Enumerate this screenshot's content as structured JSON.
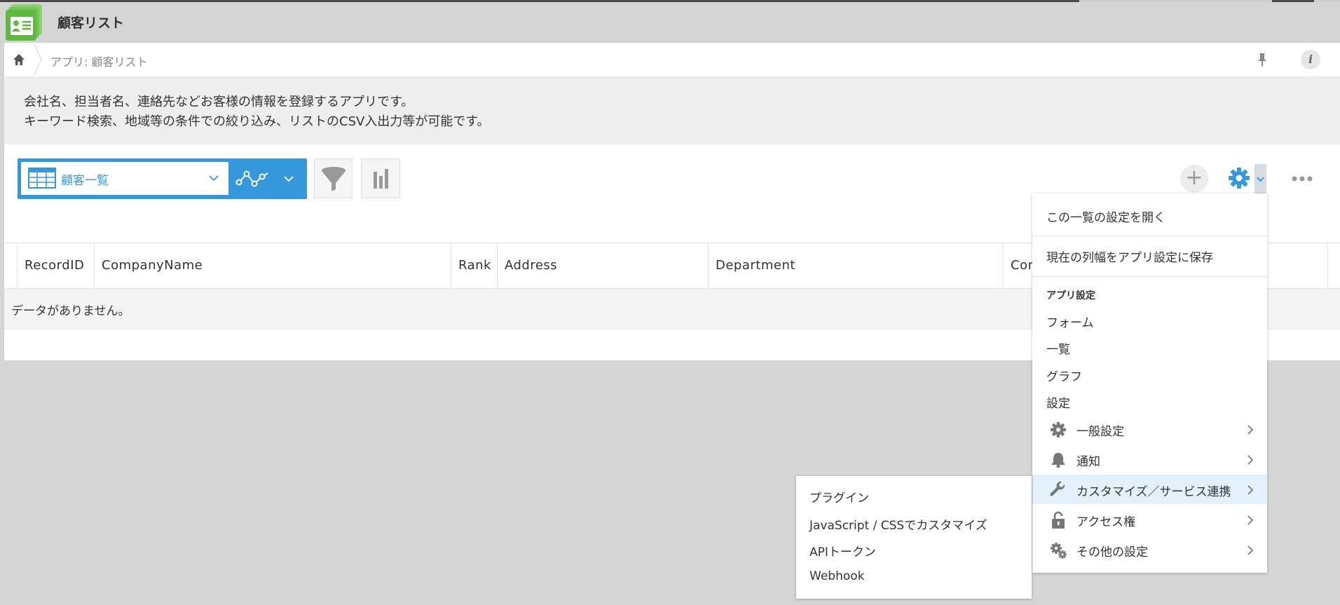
{
  "app": {
    "title": "顧客リスト"
  },
  "breadcrumb": {
    "text": "アプリ: 顧客リスト"
  },
  "description": {
    "line1": "会社名、担当者名、連絡先などお客様の情報を登録するアプリです。",
    "line2": "キーワード検索、地域等の条件での絞り込み、リストのCSV入出力等が可能です。"
  },
  "toolbar": {
    "view_name": "顧客一覧",
    "add_label": "+"
  },
  "grid": {
    "columns": [
      "RecordID",
      "CompanyName",
      "Rank",
      "Address",
      "Department",
      "Cor"
    ],
    "empty_message": "データがありません。"
  },
  "gear_menu": {
    "open_view_settings": "この一覧の設定を開く",
    "save_column_width": "現在の列幅をアプリ設定に保存",
    "app_settings_header": "アプリ設定",
    "items": [
      "フォーム",
      "一覧",
      "グラフ",
      "設定"
    ],
    "submenus": [
      {
        "label": "一般設定",
        "icon": "gear-icon"
      },
      {
        "label": "通知",
        "icon": "bell-icon"
      },
      {
        "label": "カスタマイズ／サービス連携",
        "icon": "wrench-icon"
      },
      {
        "label": "アクセス権",
        "icon": "lock-icon"
      },
      {
        "label": "その他の設定",
        "icon": "gears-icon"
      }
    ]
  },
  "customize_submenu": {
    "items": [
      "プラグイン",
      "JavaScript / CSSでカスタマイズ",
      "APIトークン",
      "Webhook"
    ]
  },
  "colors": {
    "accent": "#3498db",
    "active_bg": "#e3f1fc",
    "app_icon": "#5fb840"
  }
}
